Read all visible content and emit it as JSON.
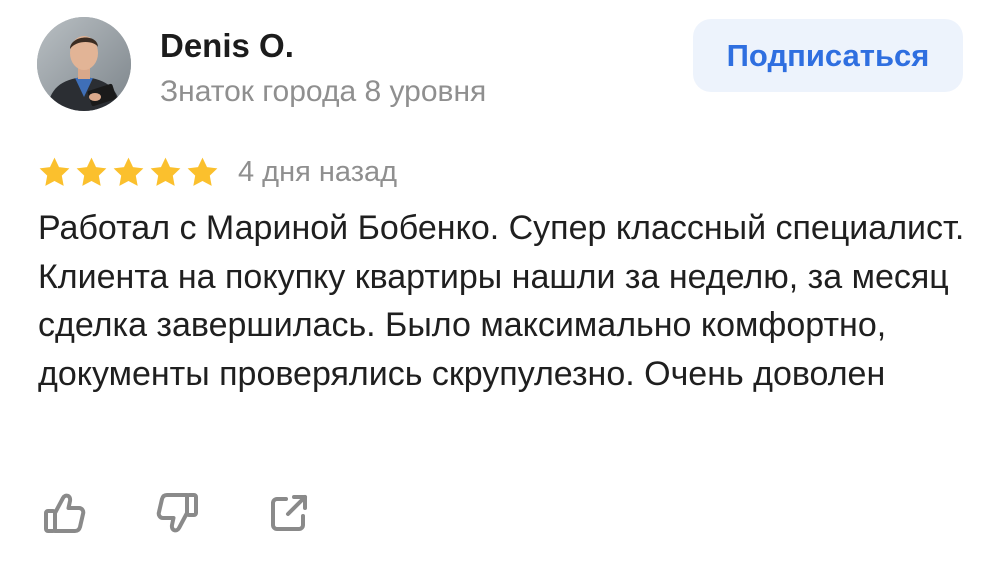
{
  "author": {
    "name": "Denis O.",
    "level": "Знаток города 8 уровня"
  },
  "subscribe_button": {
    "label": "Подписаться"
  },
  "review": {
    "rating": 5,
    "rating_max": 5,
    "date": "4 дня назад",
    "text": "Работал с Мариной Бобенко. Супер классный специалист. Клиента на покупку квартиры нашли за неделю, за месяц сделка завершилась. Было максимально комфортно, документы проверялись скрупулезно. Очень доволен"
  },
  "actions": [
    {
      "icon": "thumbs-up-icon"
    },
    {
      "icon": "thumbs-down-icon"
    },
    {
      "icon": "share-icon"
    }
  ],
  "colors": {
    "accent": "#2f6fe0",
    "button_bg": "#edf3fc",
    "star": "#fbc02d",
    "muted_text": "#8f8f8f",
    "icon": "#8a8a8a"
  }
}
